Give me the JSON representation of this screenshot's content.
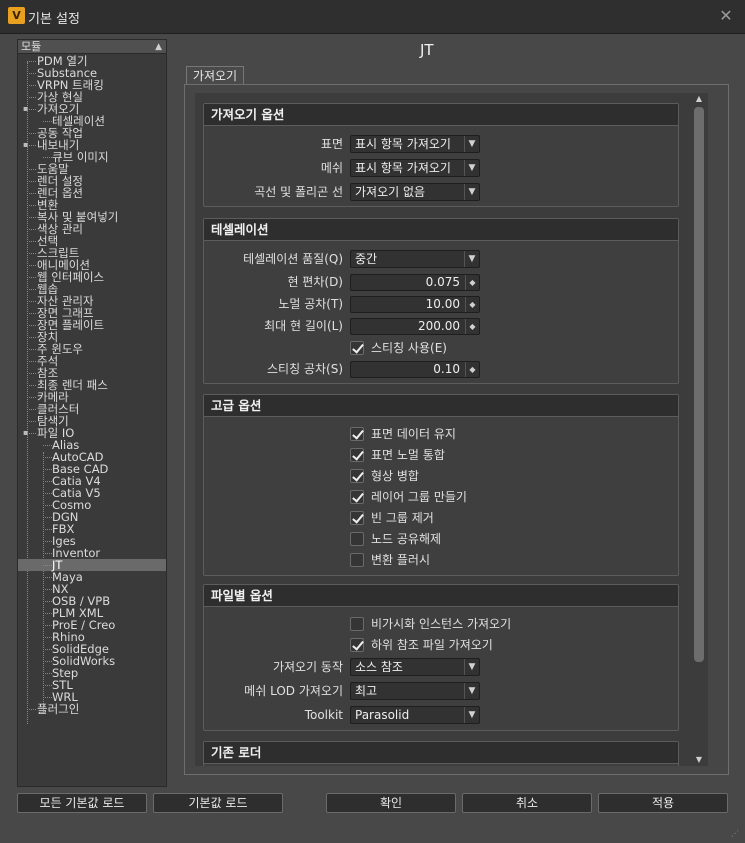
{
  "window": {
    "title": "기본 설정",
    "app_icon": "V",
    "close": "✕"
  },
  "tree": {
    "header": "모듈",
    "items": [
      {
        "label": "PDM 열기",
        "level": 0
      },
      {
        "label": "Substance",
        "level": 0
      },
      {
        "label": "VRPN 트래킹",
        "level": 0
      },
      {
        "label": "가상 현실",
        "level": 0
      },
      {
        "label": "가져오기",
        "level": 0,
        "expander": "▪"
      },
      {
        "label": "테셀레이션",
        "level": 1
      },
      {
        "label": "공동 작업",
        "level": 0
      },
      {
        "label": "내보내기",
        "level": 0,
        "expander": "▪"
      },
      {
        "label": "큐브 이미지",
        "level": 1
      },
      {
        "label": "도움말",
        "level": 0
      },
      {
        "label": "렌더 설정",
        "level": 0
      },
      {
        "label": "렌더 옵션",
        "level": 0
      },
      {
        "label": "변환",
        "level": 0
      },
      {
        "label": "복사 및 붙여넣기",
        "level": 0
      },
      {
        "label": "색상 관리",
        "level": 0
      },
      {
        "label": "선택",
        "level": 0
      },
      {
        "label": "스크립트",
        "level": 0
      },
      {
        "label": "애니메이션",
        "level": 0
      },
      {
        "label": "웹 인터페이스",
        "level": 0
      },
      {
        "label": "웹솝",
        "level": 0
      },
      {
        "label": "자산 관리자",
        "level": 0
      },
      {
        "label": "장면 그래프",
        "level": 0
      },
      {
        "label": "장면 플레이트",
        "level": 0
      },
      {
        "label": "장치",
        "level": 0
      },
      {
        "label": "주 윈도우",
        "level": 0
      },
      {
        "label": "주석",
        "level": 0
      },
      {
        "label": "참조",
        "level": 0
      },
      {
        "label": "최종 렌더 패스",
        "level": 0
      },
      {
        "label": "카메라",
        "level": 0
      },
      {
        "label": "클러스터",
        "level": 0
      },
      {
        "label": "탐색기",
        "level": 0
      },
      {
        "label": "파일 IO",
        "level": 0,
        "expander": "▪"
      },
      {
        "label": "Alias",
        "level": 1
      },
      {
        "label": "AutoCAD",
        "level": 1
      },
      {
        "label": "Base CAD",
        "level": 1
      },
      {
        "label": "Catia V4",
        "level": 1
      },
      {
        "label": "Catia V5",
        "level": 1
      },
      {
        "label": "Cosmo",
        "level": 1
      },
      {
        "label": "DGN",
        "level": 1
      },
      {
        "label": "FBX",
        "level": 1
      },
      {
        "label": "Iges",
        "level": 1
      },
      {
        "label": "Inventor",
        "level": 1
      },
      {
        "label": "JT",
        "level": 1,
        "selected": true
      },
      {
        "label": "Maya",
        "level": 1
      },
      {
        "label": "NX",
        "level": 1
      },
      {
        "label": "OSB / VPB",
        "level": 1
      },
      {
        "label": "PLM XML",
        "level": 1
      },
      {
        "label": "ProE / Creo",
        "level": 1
      },
      {
        "label": "Rhino",
        "level": 1
      },
      {
        "label": "SolidEdge",
        "level": 1
      },
      {
        "label": "SolidWorks",
        "level": 1
      },
      {
        "label": "Step",
        "level": 1
      },
      {
        "label": "STL",
        "level": 1
      },
      {
        "label": "WRL",
        "level": 1
      },
      {
        "label": "플러그인",
        "level": 0
      }
    ]
  },
  "page_title": "JT",
  "tab_label": "가져오기",
  "import_options": {
    "header": "가져오기 옵션",
    "surface_label": "표면",
    "surface_value": "표시 항목 가져오기",
    "mesh_label": "메쉬",
    "mesh_value": "표시 항목 가져오기",
    "curves_label": "곡선 및 폴리곤 선",
    "curves_value": "가져오기 없음"
  },
  "tessellation": {
    "header": "테셀레이션",
    "quality_label": "테셀레이션 품질(Q)",
    "quality_value": "중간",
    "chord_dev_label": "현 편차(D)",
    "chord_dev_value": "0.075",
    "normal_tol_label": "노멀 공차(T)",
    "normal_tol_value": "10.00",
    "max_chord_label": "최대 현 길이(L)",
    "max_chord_value": "200.00",
    "stitch_use_label": "스티칭 사용(E)",
    "stitch_use_checked": true,
    "stitch_tol_label": "스티칭 공차(S)",
    "stitch_tol_value": "0.10"
  },
  "advanced": {
    "header": "고급 옵션",
    "items": [
      {
        "label": "표면 데이터 유지",
        "checked": true
      },
      {
        "label": "표면 노멀 통합",
        "checked": true
      },
      {
        "label": "형상 병합",
        "checked": true
      },
      {
        "label": "레이어 그룹 만들기",
        "checked": true
      },
      {
        "label": "빈 그룹 제거",
        "checked": true
      },
      {
        "label": "노드 공유해제",
        "checked": false
      },
      {
        "label": "변환 플러시",
        "checked": false
      }
    ]
  },
  "per_file": {
    "header": "파일별 옵션",
    "invisible_label": "비가시화 인스턴스 가져오기",
    "invisible_checked": false,
    "subref_label": "하위 참조 파일 가져오기",
    "subref_checked": true,
    "behavior_label": "가져오기 동작",
    "behavior_value": "소스 참조",
    "lod_label": "메쉬 LOD 가져오기",
    "lod_value": "최고",
    "toolkit_label": "Toolkit",
    "toolkit_value": "Parasolid"
  },
  "legacy": {
    "header": "기존 로더"
  },
  "buttons": {
    "load_all_defaults": "모든 기본값 로드",
    "load_defaults": "기본값 로드",
    "ok": "확인",
    "cancel": "취소",
    "apply": "적용"
  }
}
